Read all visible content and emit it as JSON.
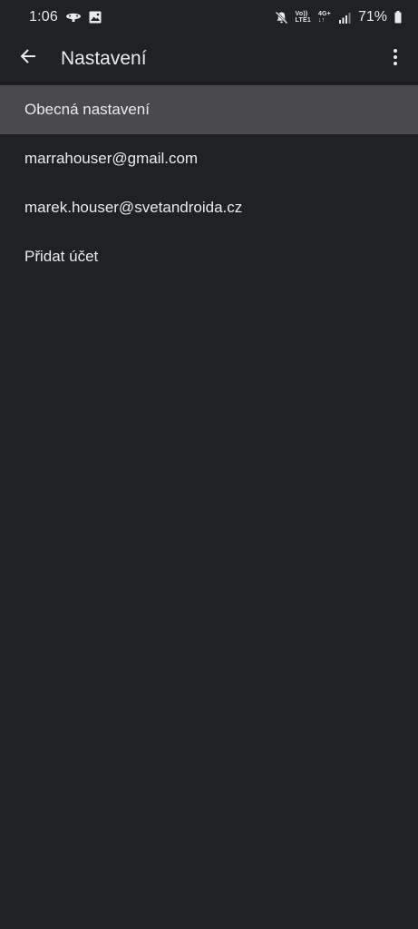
{
  "status_bar": {
    "time": "1:06",
    "net_top": "Vo))",
    "net_bottom": "LTE1",
    "net_gen": "4G+",
    "battery": "71%"
  },
  "app_bar": {
    "title": "Nastavení",
    "back_icon": "arrow-back-icon",
    "more_icon": "more-vert-icon"
  },
  "settings": {
    "items": [
      {
        "label": "Obecná nastavení",
        "selected": true
      },
      {
        "label": "marrahouser@gmail.com",
        "selected": false
      },
      {
        "label": "marek.houser@svetandroida.cz",
        "selected": false
      },
      {
        "label": "Přidat účet",
        "selected": false
      }
    ]
  },
  "colors": {
    "background": "#202124",
    "selected": "#4a4a4c",
    "text": "#e8eaed"
  }
}
